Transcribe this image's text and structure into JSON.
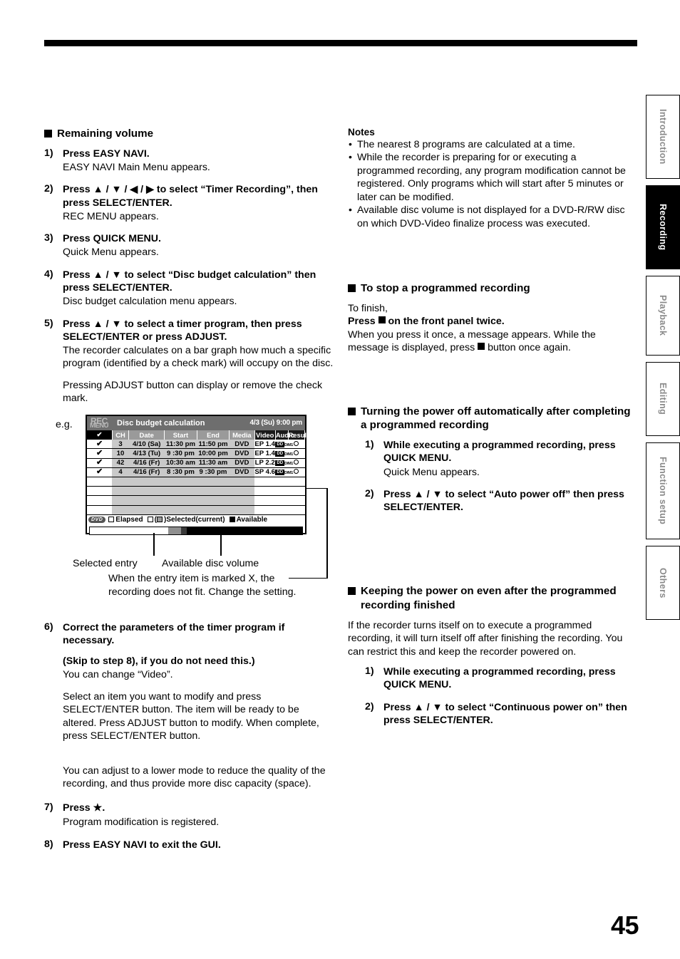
{
  "page": {
    "number": "45"
  },
  "side_tabs": [
    {
      "label": "Introduction",
      "active": false
    },
    {
      "label": "Recording",
      "active": true
    },
    {
      "label": "Playback",
      "active": false
    },
    {
      "label": "Editing",
      "active": false
    },
    {
      "label": "Function setup",
      "active": false
    },
    {
      "label": "Others",
      "active": false
    }
  ],
  "left_column": {
    "section_title": "Remaining volume",
    "steps": [
      {
        "num": "1)",
        "title": "Press EASY NAVI.",
        "body": "EASY NAVI Main Menu appears."
      },
      {
        "num": "2)",
        "title": "Press ▲ / ▼ / ◀ / ▶ to select “Timer Recording”, then press SELECT/ENTER.",
        "body": "REC MENU appears."
      },
      {
        "num": "3)",
        "title": "Press QUICK MENU.",
        "body": "Quick Menu appears."
      },
      {
        "num": "4)",
        "title": "Press ▲ / ▼ to select “Disc budget calculation” then press SELECT/ENTER.",
        "body": "Disc budget calculation menu appears."
      },
      {
        "num": "5)",
        "title": "Press ▲ / ▼ to select a timer program, then press SELECT/ENTER or press ADJUST.",
        "body": "The recorder calculates on a bar graph how much a specific program (identified by a check mark) will occupy on the disc.",
        "body2": "Pressing ADJUST button can display or remove the check mark."
      }
    ],
    "eg_label": "e.g.",
    "figure_captions": {
      "selected_entry": "Selected entry",
      "available_disc_volume": "Available disc volume",
      "x_note_line1": "When the entry item is marked X, the",
      "x_note_line2": "recording does not fit. Change the setting."
    },
    "steps_after": [
      {
        "num": "6)",
        "title": "Correct the parameters of the timer program if necessary.",
        "title2": "(Skip to step 8), if you do not need this.)",
        "body": "You can change “Video”.",
        "body2": "Select an item you want to modify and press SELECT/ENTER button. The item will be ready to be altered. Press ADJUST button to modify. When complete, press SELECT/ENTER button.",
        "body3": "You can adjust to a lower mode to reduce the quality of the recording, and thus provide more disc capacity (space)."
      },
      {
        "num": "7)",
        "title": "Press ★.",
        "body": "Program modification is registered."
      },
      {
        "num": "8)",
        "title": "Press EASY NAVI to exit the GUI.",
        "body": ""
      }
    ]
  },
  "screen": {
    "logo_line1": "REC",
    "logo_line2": "MENU",
    "title": "Disc budget calculation",
    "clock": "4/3 (Su) 9:00 pm",
    "columns": [
      "✔",
      "CH",
      "Date",
      "Start",
      "End",
      "Media",
      "Video",
      "Audio",
      "Result"
    ],
    "rows": [
      {
        "check": "✔",
        "ch": "3",
        "date": "4/10 (Sa)",
        "start": "11:30 pm",
        "end": "11:50 pm",
        "media": "DVD",
        "video": "EP 1.4",
        "audio": "D/M1",
        "result": "○"
      },
      {
        "check": "✔",
        "ch": "10",
        "date": "4/13 (Tu)",
        "start": "9 :30 pm",
        "end": "10:00 pm",
        "media": "DVD",
        "video": "EP 1.4",
        "audio": "D/M1",
        "result": "○"
      },
      {
        "check": "✔",
        "ch": "42",
        "date": "4/16 (Fr)",
        "start": "10:30 am",
        "end": "11:30 am",
        "media": "DVD",
        "video": "LP 2.2",
        "audio": "D/M1",
        "result": "○"
      },
      {
        "check": "✔",
        "ch": "4",
        "date": "4/16 (Fr)",
        "start": "8 :30 pm",
        "end": "9 :30 pm",
        "media": "DVD",
        "video": "SP 4.6",
        "audio": "D/M1",
        "result": "○"
      }
    ],
    "empty_row_count": 4,
    "legend": {
      "media_badge": "DVD",
      "elapsed": "Elapsed",
      "selected": ")Selected(current)",
      "selected_prefix": "(",
      "available": "Available"
    },
    "bar": {
      "elapsed_pct": 37,
      "selected_pct": 8.5,
      "available_pct": 54.5
    }
  },
  "right_column": {
    "notes_title": "Notes",
    "notes": [
      "The nearest 8 programs are calculated at a time.",
      "While the recorder is preparing for or executing a programmed recording, any program modification cannot be registered. Only programs which will start after 5 minutes or later can be modified.",
      "Available disc volume is not displayed for a DVD-R/RW disc on which DVD-Video finalize process was executed."
    ],
    "stop_section": {
      "title": "To stop a programmed recording",
      "line1": "To finish,",
      "line2_pre": "Press ",
      "line2_post": " on the front panel twice.",
      "line3_a": "When you press it once, a message appears. While the message is displayed, press ",
      "line3_b": " button once again."
    },
    "autopower_section": {
      "title": "Turning the power off automatically after completing a programmed recording",
      "steps": [
        {
          "num": "1)",
          "title": "While executing a programmed recording, press QUICK MENU.",
          "body": "Quick Menu appears."
        },
        {
          "num": "2)",
          "title": "Press ▲ / ▼ to select “Auto power off” then press SELECT/ENTER.",
          "body": ""
        }
      ]
    },
    "keeppower_section": {
      "title": "Keeping the power on even after the programmed recording finished",
      "body": "If the recorder turns itself on to execute a programmed recording, it will turn itself off after finishing the recording. You can restrict this and keep the recorder powered on.",
      "steps": [
        {
          "num": "1)",
          "title": "While executing a programmed recording, press QUICK MENU.",
          "body": ""
        },
        {
          "num": "2)",
          "title": "Press ▲ / ▼ to select “Continuous power on” then press SELECT/ENTER.",
          "body": ""
        }
      ]
    }
  }
}
